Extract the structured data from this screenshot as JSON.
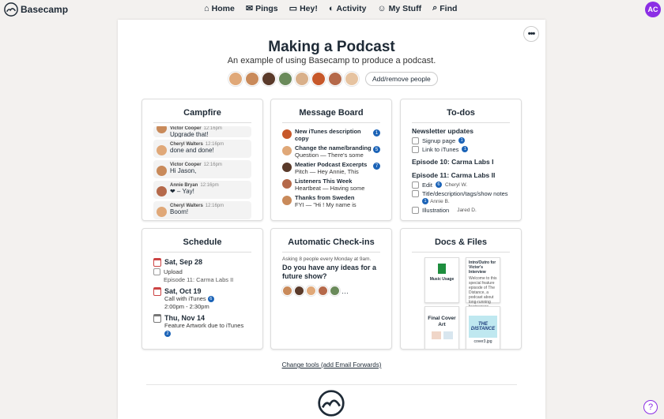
{
  "brand": {
    "name": "Basecamp"
  },
  "nav": {
    "items": [
      {
        "label": "Home",
        "icon": "home-icon"
      },
      {
        "label": "Pings",
        "icon": "pings-icon"
      },
      {
        "label": "Hey!",
        "icon": "hey-icon"
      },
      {
        "label": "Activity",
        "icon": "activity-icon"
      },
      {
        "label": "My Stuff",
        "icon": "mystuff-icon"
      },
      {
        "label": "Find",
        "icon": "search-icon"
      }
    ],
    "avatar": "AC",
    "avatar_color": "#8b2ee5"
  },
  "project": {
    "title": "Making a Podcast",
    "subtitle": "An example of using Basecamp to produce a podcast.",
    "people_button": "Add/remove people",
    "more_label": "•••"
  },
  "campfire": {
    "title": "Campfire",
    "messages": [
      {
        "author": "Victor Cooper",
        "time": "12:16pm",
        "text": "Upgrade that!"
      },
      {
        "author": "Cheryl Walters",
        "time": "12:16pm",
        "text": "done and done!"
      },
      {
        "author": "Victor Cooper",
        "time": "12:16pm",
        "text": "Hi Jason,"
      },
      {
        "author": "Annie Bryan",
        "time": "12:16pm",
        "text": "❤ – Yay!"
      },
      {
        "author": "Cheryl Walters",
        "time": "12:16pm",
        "text": "Boom!"
      }
    ]
  },
  "message_board": {
    "title": "Message Board",
    "items": [
      {
        "title": "New iTunes description copy",
        "sub": "",
        "badge": "1"
      },
      {
        "title": "Change the name/branding",
        "sub": "Question — There's some",
        "badge": "5"
      },
      {
        "title": "Meatier Podcast Excerpts",
        "sub": "Pitch — Hey Annie, This",
        "badge": "7"
      },
      {
        "title": "Listeners This Week",
        "sub": "Heartbeat — Having some",
        "badge": ""
      },
      {
        "title": "Thanks from Sweden",
        "sub": "FYI — \"Hi ! My name is",
        "badge": ""
      }
    ]
  },
  "todos": {
    "title": "To-dos",
    "lists": [
      {
        "name": "Newsletter updates",
        "items": [
          {
            "text": "Signup page",
            "badge": "1"
          },
          {
            "text": "Link to iTunes",
            "badge": "1"
          }
        ]
      },
      {
        "name": "Episode 10: Carma Labs I",
        "items": []
      },
      {
        "name": "Episode 11: Carma Labs II",
        "items": [
          {
            "text": "Edit",
            "badge": "6",
            "assignee": "Cheryl W."
          },
          {
            "text": "Title/description/tags/show notes",
            "badge": "1",
            "assignee": "Annie B."
          },
          {
            "text": "Illustration",
            "badge": "",
            "assignee": "Jared D."
          }
        ]
      }
    ]
  },
  "schedule": {
    "title": "Schedule",
    "events": [
      {
        "date": "Sat, Sep 28",
        "line1": "Upload",
        "line2": "Episode 11: Carma Labs II"
      },
      {
        "date": "Sat, Oct 19",
        "line1": "Call with iTunes",
        "badge": "6",
        "line2": "2:00pm - 2:30pm"
      },
      {
        "date": "Thu, Nov 14",
        "line1": "Feature Artwork due to iTunes",
        "badge": "2",
        "line2": ""
      }
    ]
  },
  "checkins": {
    "title": "Automatic Check-ins",
    "asking": "Asking 8 people every Monday at 9am.",
    "question": "Do you have any ideas for a future show?",
    "more": "…"
  },
  "docs": {
    "title": "Docs & Files",
    "items": [
      {
        "name": "Music Usage",
        "kind": "sheet"
      },
      {
        "name": "Intro/Outro for Victor's Interview",
        "kind": "doc",
        "body": "Welcome to this special feature episode of The Distance, a podcast about long-running businesses. Annie"
      },
      {
        "name": "Final Cover Art",
        "kind": "folder"
      },
      {
        "name": "cover3.jpg",
        "kind": "image",
        "art": "THE DISTANCE"
      }
    ]
  },
  "footer": {
    "change_tools": "Change tools (add Email Forwards)",
    "help": "?"
  }
}
